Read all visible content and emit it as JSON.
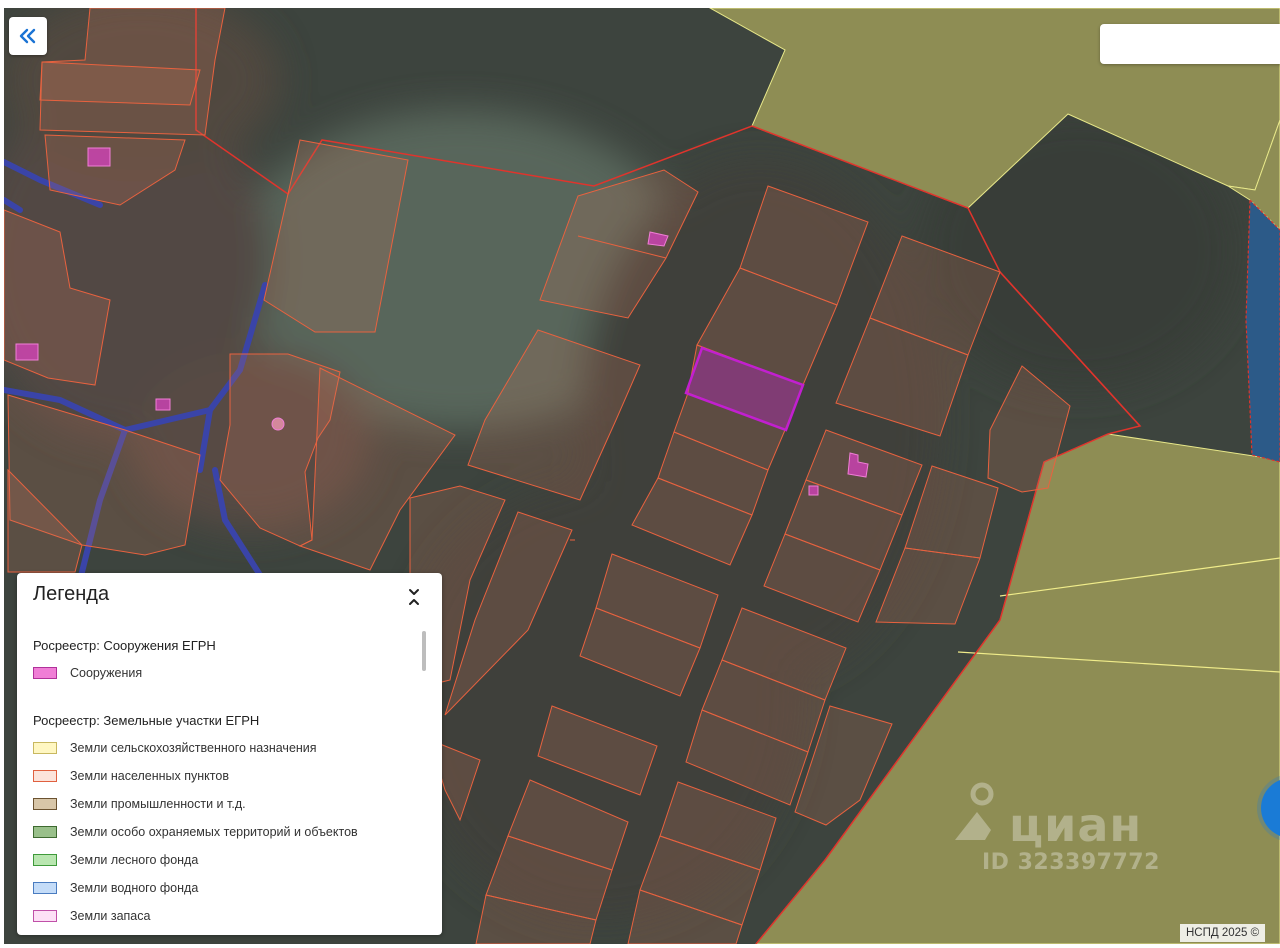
{
  "map": {
    "attribution": "НСПД 2025 ©",
    "watermark_brand": "циан",
    "watermark_id": "ID 323397772"
  },
  "legend": {
    "title": "Легенда",
    "groups": [
      {
        "title": "Росреестр: Сооружения ЕГРН",
        "items": [
          {
            "label": "Сооружения",
            "color": "#f07ed6"
          }
        ]
      },
      {
        "title": "Росреестр: Земельные участки ЕГРН",
        "items": [
          {
            "label": "Земли сельскохозяйственного назначения",
            "color": "#fff7c2"
          },
          {
            "label": "Земли населенных пунктов",
            "color": "#fce3da"
          },
          {
            "label": "Земли промышленности и т.д.",
            "color": "#d8c6a8"
          },
          {
            "label": "Земли особо охраняемых территорий и объектов",
            "color": "#99c08a"
          },
          {
            "label": "Земли лесного фонда",
            "color": "#b9e6b0"
          },
          {
            "label": "Земли водного фонда",
            "color": "#c4dcf8"
          },
          {
            "label": "Земли запаса",
            "color": "#fde0f6"
          }
        ]
      }
    ]
  },
  "colors": {
    "parcel_outline": "#e8623f",
    "settlement_boundary": "#e0342c",
    "agri_fill": "#8e8e52",
    "highlight": "#c21fd0",
    "structure": "#e040c8",
    "road": "#3a44a8"
  }
}
